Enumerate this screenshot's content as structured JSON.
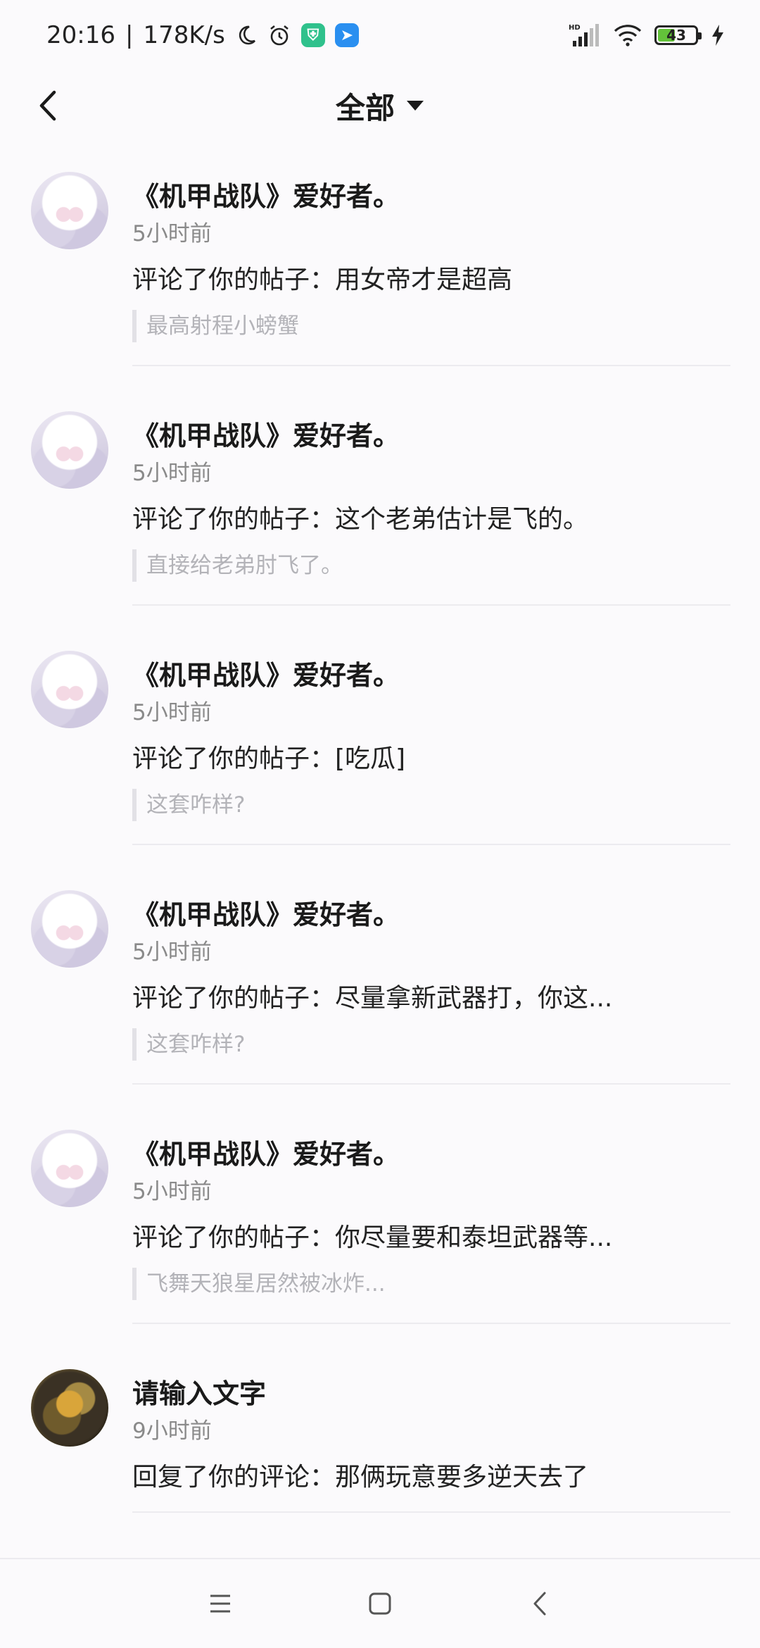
{
  "status_bar": {
    "time": "20:16",
    "separator": "|",
    "net_speed": "178K/s",
    "battery_level": "43",
    "hd_label": "HD"
  },
  "header": {
    "title": "全部"
  },
  "notifications": [
    {
      "name": "《机甲战队》爱好者。",
      "time": "5小时前",
      "action": "评论了你的帖子：用女帝才是超高",
      "quote": "最高射程小螃蟹",
      "avatar": "anime-avatar"
    },
    {
      "name": "《机甲战队》爱好者。",
      "time": "5小时前",
      "action": "评论了你的帖子：这个老弟估计是飞的。",
      "quote": "直接给老弟肘飞了。",
      "avatar": "anime-avatar"
    },
    {
      "name": "《机甲战队》爱好者。",
      "time": "5小时前",
      "action": "评论了你的帖子：[吃瓜]",
      "quote": "这套咋样?",
      "avatar": "anime-avatar"
    },
    {
      "name": "《机甲战队》爱好者。",
      "time": "5小时前",
      "action": "评论了你的帖子：尽量拿新武器打，你这...",
      "quote": "这套咋样?",
      "avatar": "anime-avatar"
    },
    {
      "name": "《机甲战队》爱好者。",
      "time": "5小时前",
      "action": "评论了你的帖子：你尽量要和泰坦武器等...",
      "quote": "飞舞天狼星居然被冰炸...",
      "avatar": "anime-avatar"
    },
    {
      "name": "请输入文字",
      "time": "9小时前",
      "action": "回复了你的评论：那俩玩意要多逆天去了",
      "avatar": "mech-avatar"
    }
  ],
  "colors": {
    "background": "#fbfafc",
    "battery_fill": "#63c23a",
    "app_badge_1": "#2fc18c",
    "app_badge_2": "#2a8ff0"
  }
}
